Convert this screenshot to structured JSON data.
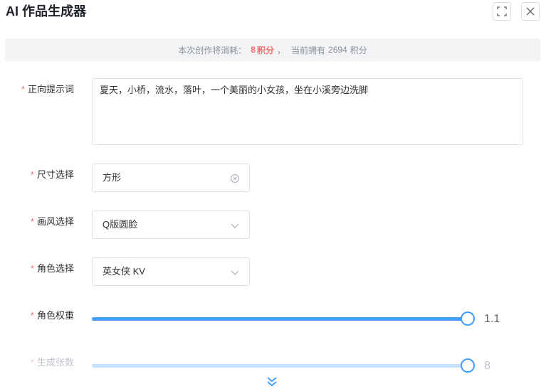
{
  "dialog": {
    "title": "AI 作品生成器",
    "fullscreen_icon": "fullscreen-icon",
    "close_icon": "close-icon"
  },
  "cost": {
    "prefix": "本次创作将消耗：",
    "value": "8",
    "unit": "积分",
    "separator": "，",
    "balance_prefix": "当前拥有",
    "balance": "2694",
    "balance_unit": "积分"
  },
  "form": {
    "prompt": {
      "label": "正向提示词",
      "value": "夏天，小桥，流水，落叶，一个美丽的小女孩，坐在小溪旁边洗脚"
    },
    "size": {
      "label": "尺寸选择",
      "value": "方形",
      "icon": "circle-close-icon"
    },
    "style": {
      "label": "画风选择",
      "value": "Q版圆脸",
      "icon": "chevron-down-icon"
    },
    "character": {
      "label": "角色选择",
      "value": "英女侠 KV",
      "icon": "chevron-down-icon"
    },
    "character_weight": {
      "label": "角色权重",
      "value": "1.1",
      "fraction": 1.0
    },
    "count": {
      "label": "生成张数",
      "value": "8",
      "fraction": 1.0,
      "disabled": true
    }
  },
  "expand_icon": "double-chevron-down-icon",
  "colors": {
    "accent": "#409eff",
    "required": "#f56c6c",
    "cost_highlight": "#f56c6c"
  }
}
